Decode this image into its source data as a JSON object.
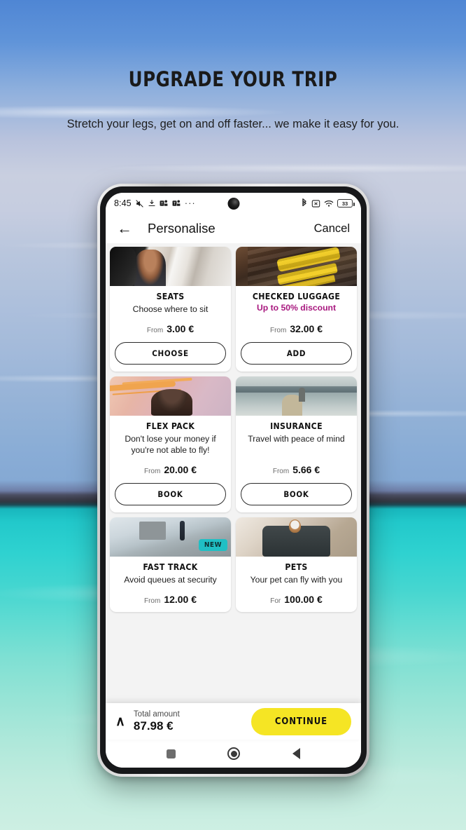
{
  "hero": {
    "title": "UPGRADE YOUR TRIP",
    "subtitle": "Stretch your legs, get on and off faster... we make it easy for you."
  },
  "colors": {
    "promo_magenta": "#a8187f",
    "badge_teal": "#20bfc4",
    "continue_yellow": "#f5e524"
  },
  "phone": {
    "status_bar": {
      "time": "8:45",
      "icons_left": [
        "mute-icon",
        "download-icon",
        "teams-icon",
        "teams-icon",
        "more-dots-icon"
      ],
      "more": "···",
      "icons_right": [
        "bluetooth-icon",
        "sim-x-icon",
        "wifi-icon",
        "battery-icon"
      ],
      "battery_level": "33"
    },
    "app_bar": {
      "back": "←",
      "title": "Personalise",
      "cancel": "Cancel"
    },
    "cards": [
      {
        "id": "seats",
        "thumb": "th-seats",
        "title": "SEATS",
        "subtitle": "Choose where to sit",
        "promo": "",
        "price_prefix": "From",
        "price": "3.00 €",
        "button": "CHOOSE",
        "badge": ""
      },
      {
        "id": "checked-luggage",
        "thumb": "th-luggage",
        "title": "CHECKED LUGGAGE",
        "subtitle": "",
        "promo": "Up to 50% discount",
        "price_prefix": "From",
        "price": "32.00 €",
        "button": "ADD",
        "badge": ""
      },
      {
        "id": "flex-pack",
        "thumb": "th-flex",
        "title": "FLEX PACK",
        "subtitle": "Don't lose your money if you're not able to fly!",
        "promo": "",
        "price_prefix": "From",
        "price": "20.00 €",
        "button": "BOOK",
        "badge": ""
      },
      {
        "id": "insurance",
        "thumb": "th-insurance",
        "title": "INSURANCE",
        "subtitle": "Travel with peace of mind",
        "promo": "",
        "price_prefix": "From",
        "price": "5.66 €",
        "button": "BOOK",
        "badge": ""
      },
      {
        "id": "fast-track",
        "thumb": "th-fast",
        "title": "FAST TRACK",
        "subtitle": "Avoid queues at security",
        "promo": "",
        "price_prefix": "From",
        "price": "12.00 €",
        "button": "",
        "badge": "NEW"
      },
      {
        "id": "pets",
        "thumb": "th-pets",
        "title": "PETS",
        "subtitle": "Your pet can fly with you",
        "promo": "",
        "price_prefix": "For",
        "price": "100.00 €",
        "button": "",
        "badge": ""
      }
    ],
    "total_bar": {
      "chevron": "∧",
      "label": "Total amount",
      "amount": "87.98 €",
      "continue_label": "CONTINUE"
    },
    "nav_bar": {
      "recents": "recents-square-icon",
      "home": "home-circle-icon",
      "back": "back-triangle-icon"
    }
  }
}
